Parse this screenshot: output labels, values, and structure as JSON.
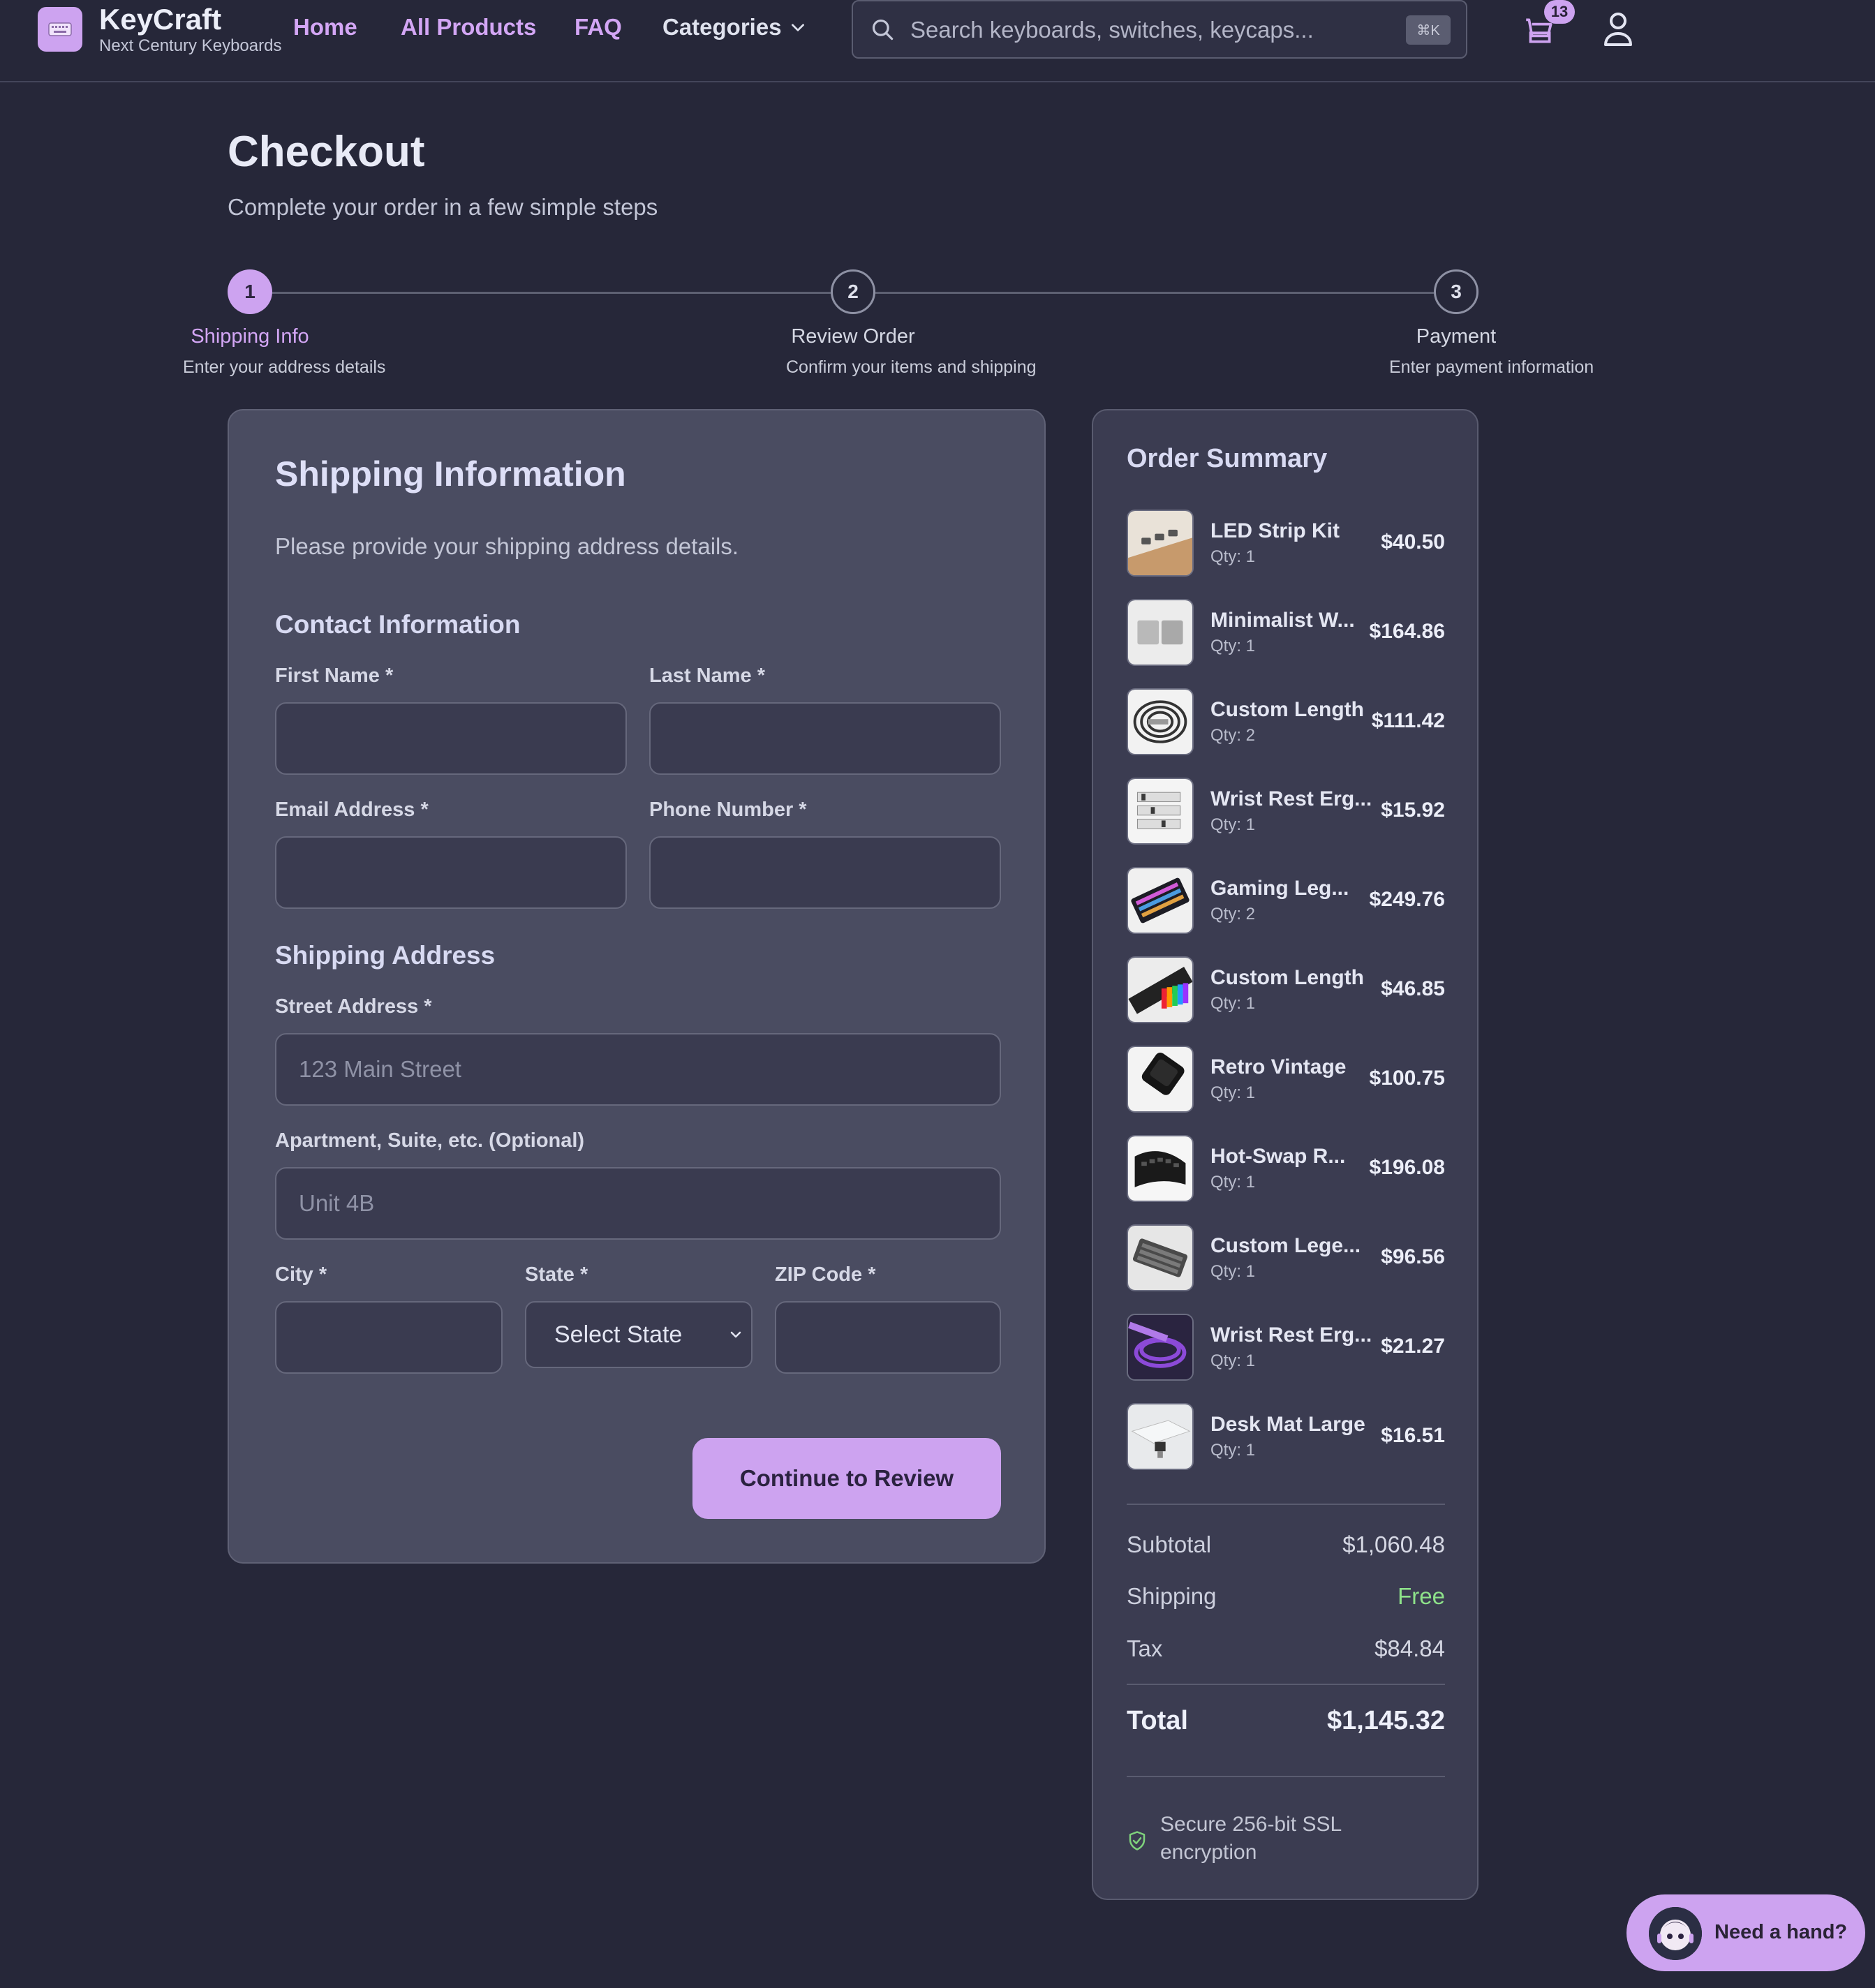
{
  "header": {
    "brand": "KeyCraft",
    "tagline": "Next Century Keyboards",
    "nav": {
      "home": "Home",
      "all_products": "All Products",
      "faq": "FAQ",
      "categories": "Categories"
    },
    "search": {
      "placeholder": "Search keyboards, switches, keycaps...",
      "shortcut": "⌘K"
    },
    "cart_count": "13",
    "icons": [
      "keyboard-logo-icon",
      "chevron-down-icon",
      "search-icon",
      "cart-icon",
      "user-icon"
    ]
  },
  "page": {
    "title": "Checkout",
    "subtitle": "Complete your order in a few simple steps"
  },
  "steps": [
    {
      "number": "1",
      "label": "Shipping Info",
      "desc": "Enter your address details",
      "active": true
    },
    {
      "number": "2",
      "label": "Review Order",
      "desc": "Confirm your items and shipping",
      "active": false
    },
    {
      "number": "3",
      "label": "Payment",
      "desc": "Enter payment information",
      "active": false
    }
  ],
  "shipping": {
    "title": "Shipping Information",
    "desc": "Please provide your shipping address details.",
    "contact_title": "Contact Information",
    "first_name_label": "First Name *",
    "last_name_label": "Last Name *",
    "email_label": "Email Address *",
    "phone_label": "Phone Number *",
    "address_title": "Shipping Address",
    "street_label": "Street Address *",
    "street_placeholder": "123 Main Street",
    "apt_label": "Apartment, Suite, etc. (Optional)",
    "apt_placeholder": "Unit 4B",
    "city_label": "City *",
    "state_label": "State *",
    "state_value": "Select State",
    "zip_label": "ZIP Code *",
    "continue_label": "Continue to Review"
  },
  "summary": {
    "title": "Order Summary",
    "items": [
      {
        "name": "LED Strip Kit",
        "qty": "Qty: 1",
        "price": "$40.50"
      },
      {
        "name": "Minimalist W...",
        "qty": "Qty: 1",
        "price": "$164.86"
      },
      {
        "name": "Custom Length",
        "qty": "Qty: 2",
        "price": "$111.42"
      },
      {
        "name": "Wrist Rest Erg...",
        "qty": "Qty: 1",
        "price": "$15.92"
      },
      {
        "name": "Gaming Leg...",
        "qty": "Qty: 2",
        "price": "$249.76"
      },
      {
        "name": "Custom Length",
        "qty": "Qty: 1",
        "price": "$46.85"
      },
      {
        "name": "Retro Vintage",
        "qty": "Qty: 1",
        "price": "$100.75"
      },
      {
        "name": "Hot-Swap R...",
        "qty": "Qty: 1",
        "price": "$196.08"
      },
      {
        "name": "Custom Lege...",
        "qty": "Qty: 1",
        "price": "$96.56"
      },
      {
        "name": "Wrist Rest Erg...",
        "qty": "Qty: 1",
        "price": "$21.27"
      },
      {
        "name": "Desk Mat Large",
        "qty": "Qty: 1",
        "price": "$16.51"
      }
    ],
    "subtotal_label": "Subtotal",
    "subtotal": "$1,060.48",
    "shipping_label": "Shipping",
    "shipping": "Free",
    "tax_label": "Tax",
    "tax": "$84.84",
    "total_label": "Total",
    "total": "$1,145.32",
    "secure_text": "Secure 256-bit SSL encryption"
  },
  "help": {
    "label": "Need a hand?"
  },
  "colors": {
    "background": "#262739",
    "accent": "#cda3f0",
    "card": "#4a4c61",
    "free": "#8ee28a"
  }
}
